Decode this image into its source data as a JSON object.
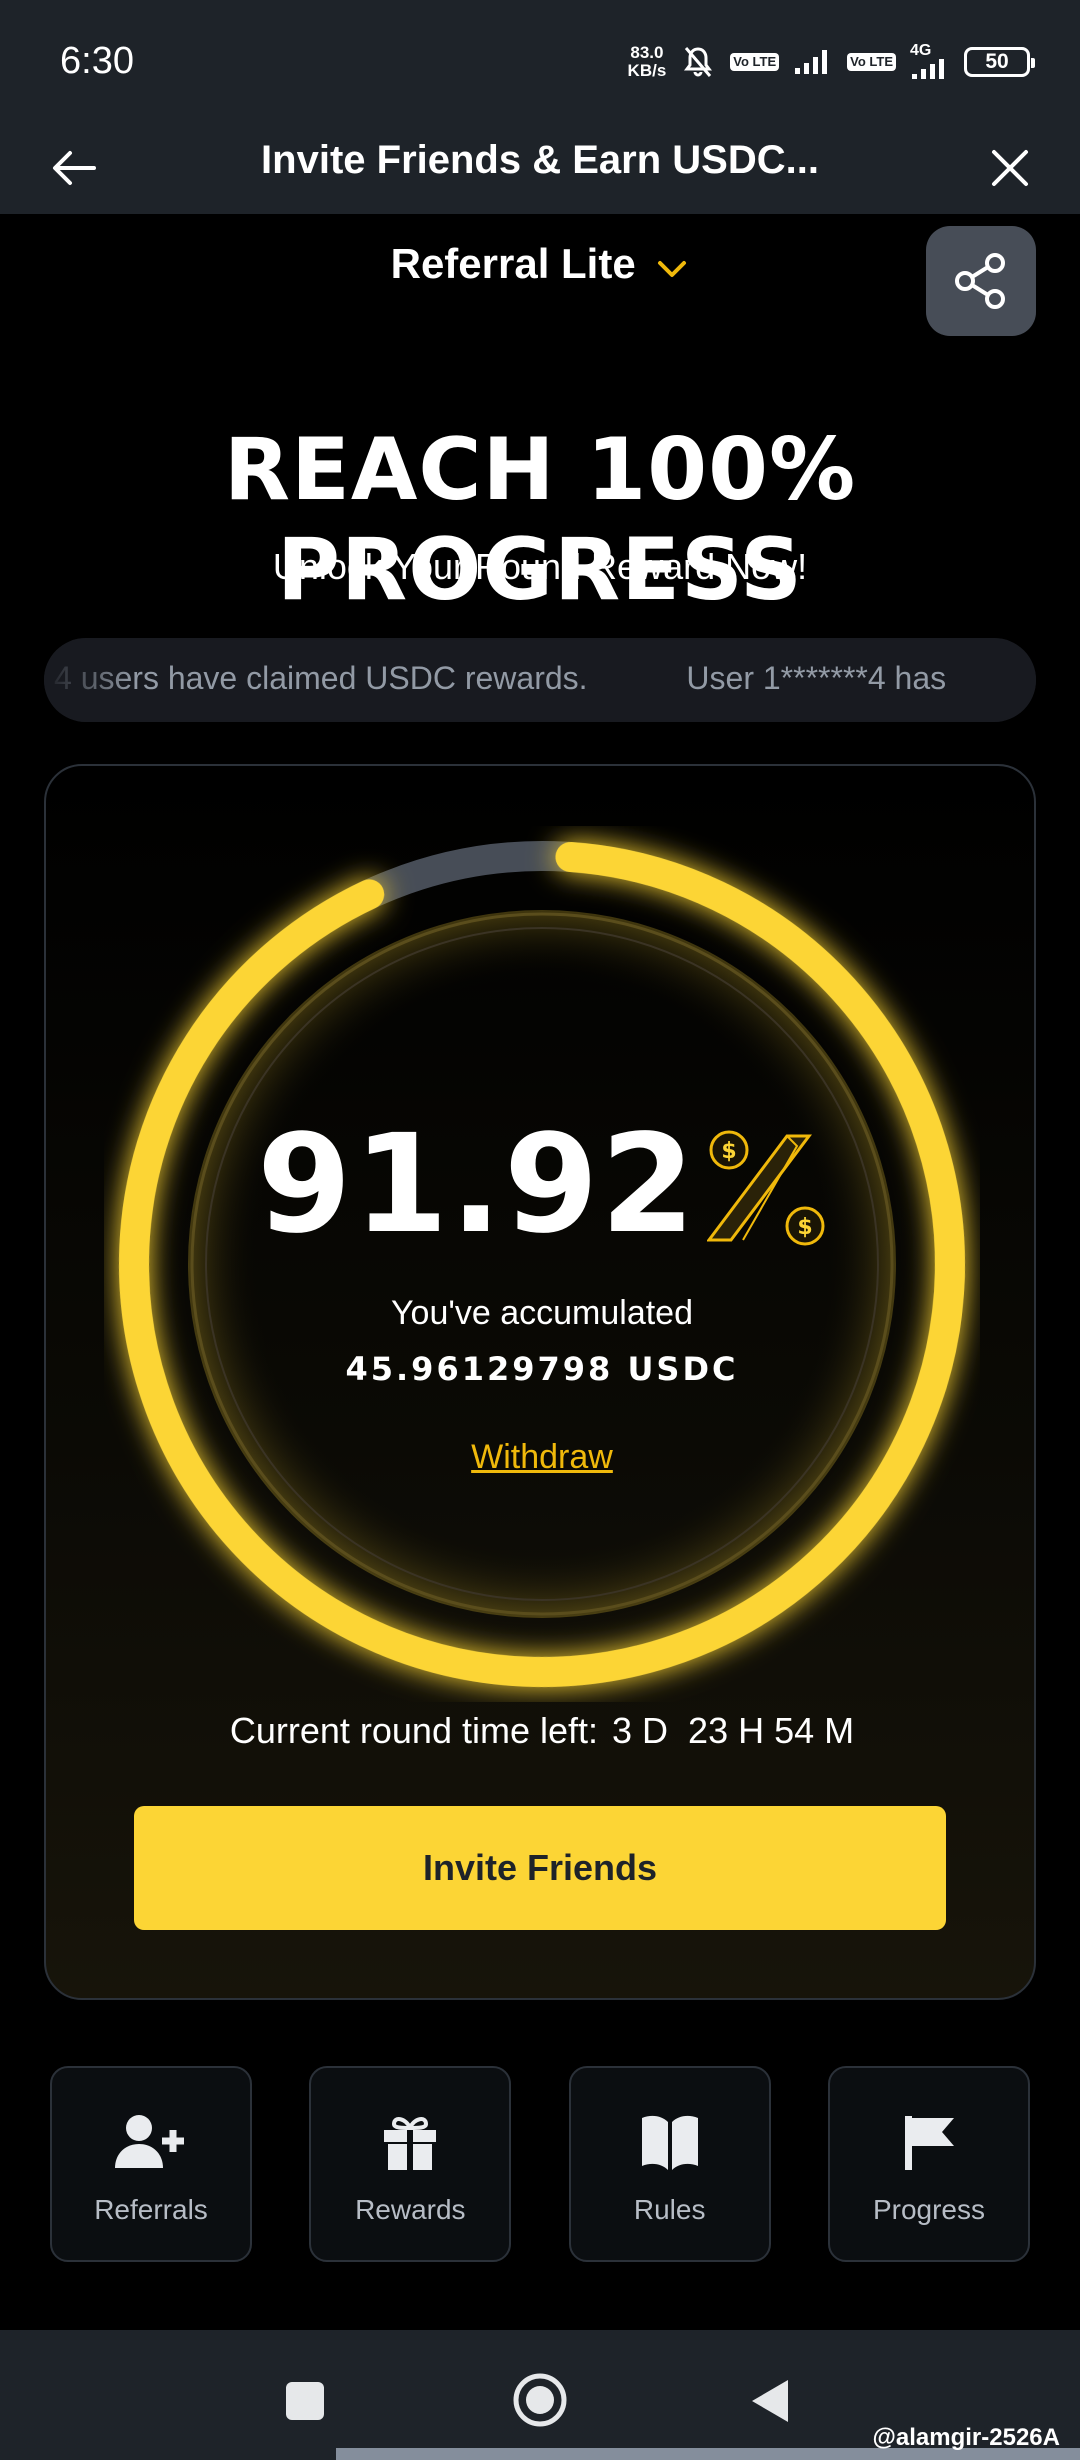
{
  "status_bar": {
    "time": "6:30",
    "net_speed_value": "83.0",
    "net_speed_unit": "KB/s",
    "network_label": "4G",
    "volte_label": "Vo LTE",
    "battery": "50"
  },
  "header": {
    "title": "Invite Friends & Earn USDC...",
    "back_icon": "arrow-left-icon",
    "close_icon": "close-icon"
  },
  "program": {
    "label": "Referral Lite",
    "dropdown_icon": "chevron-down-icon",
    "share_icon": "share-icon"
  },
  "hero": {
    "headline": "REACH 100% PROGRESS",
    "subline": "Unlock Your Round Reward Now!"
  },
  "ticker": {
    "items": [
      "4 users have claimed USDC rewards.",
      "User 1*******4 has"
    ]
  },
  "progress": {
    "percent": "91.92",
    "percent_value": 91.92,
    "accumulated_label": "You've accumulated",
    "accumulated_value": "45.96129798 USDC",
    "withdraw_label": "Withdraw",
    "time_left_label": "Current round time left:",
    "time_left_value": "3 D  23 H 54 M",
    "invite_button": "Invite Friends"
  },
  "actions": [
    {
      "label": "Referrals",
      "icon": "add-user-icon"
    },
    {
      "label": "Rewards",
      "icon": "gift-icon"
    },
    {
      "label": "Rules",
      "icon": "book-icon"
    },
    {
      "label": "Progress",
      "icon": "flag-icon"
    }
  ],
  "colors": {
    "accent": "#fcd535",
    "panel": "#1e2329",
    "ring_track": "#474d57"
  },
  "watermark": "@alamgir-2526A"
}
